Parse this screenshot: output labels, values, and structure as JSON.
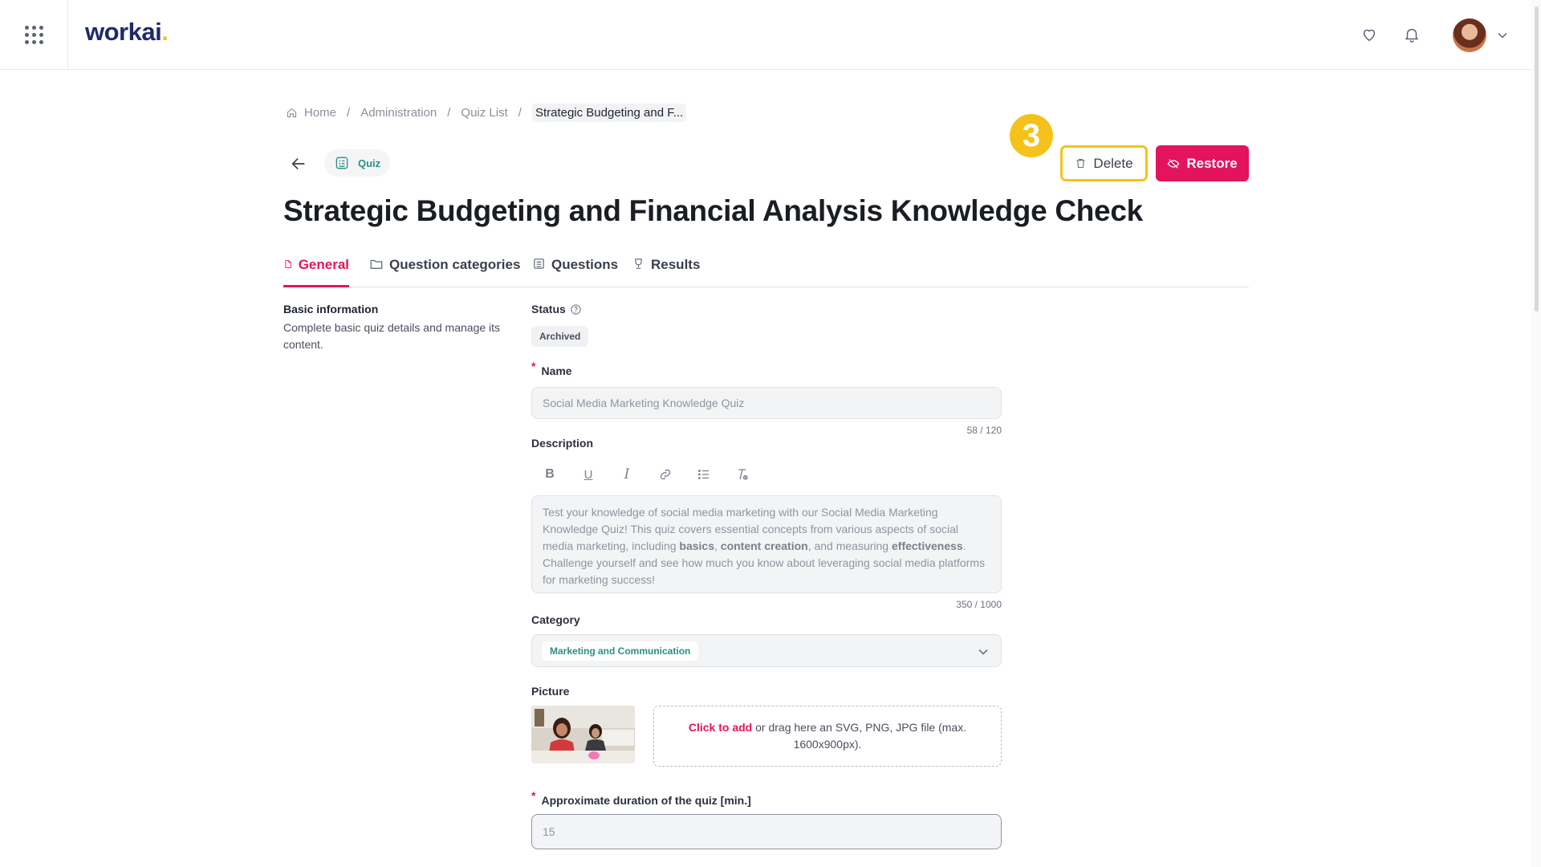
{
  "topbar": {
    "logo_text": "workai",
    "logo_dot": ".",
    "icons": [
      "apps-grid-icon",
      "heart-icon",
      "bell-icon",
      "chevron-down-icon"
    ]
  },
  "breadcrumb": {
    "items": [
      "Home",
      "Administration",
      "Quiz List"
    ],
    "current": "Strategic Budgeting and F...",
    "separator": "/"
  },
  "header": {
    "type_chip": "Quiz",
    "step_badge": "3",
    "delete_label": "Delete",
    "restore_label": "Restore",
    "title": "Strategic Budgeting and Financial Analysis Knowledge Check"
  },
  "tabs": [
    {
      "label": "General",
      "active": true
    },
    {
      "label": "Question categories",
      "active": false
    },
    {
      "label": "Questions",
      "active": false
    },
    {
      "label": "Results",
      "active": false
    }
  ],
  "section": {
    "title": "Basic information",
    "description": "Complete basic quiz details and manage its content."
  },
  "form": {
    "status_label": "Status",
    "status_value": "Archived",
    "name_label": "Name",
    "name_required": "*",
    "name_value": "Social Media Marketing Knowledge Quiz",
    "name_counter": "58 / 120",
    "description_label": "Description",
    "description_parts": [
      "Test your knowledge of social media marketing with our Social Media Marketing Knowledge Quiz! This quiz covers essential concepts from various aspects of social media marketing, including ",
      "basics",
      ", ",
      "content creation",
      ", and measuring ",
      "effectiveness",
      ". Challenge yourself and see how much you know about leveraging social media platforms for marketing success!"
    ],
    "description_counter": "350 / 1000",
    "category_label": "Category",
    "category_value": "Marketing and Communication",
    "picture_label": "Picture",
    "dropzone_link": "Click to add",
    "dropzone_text": " or drag here an SVG, PNG, JPG file (max. 1600x900px).",
    "duration_label": "Approximate duration of the quiz [min.]",
    "duration_required": "*",
    "duration_value": "15"
  },
  "colors": {
    "accent": "#e3145d",
    "highlight": "#f5c21b",
    "teal": "#2a8f80",
    "brand": "#1e2a6b"
  }
}
